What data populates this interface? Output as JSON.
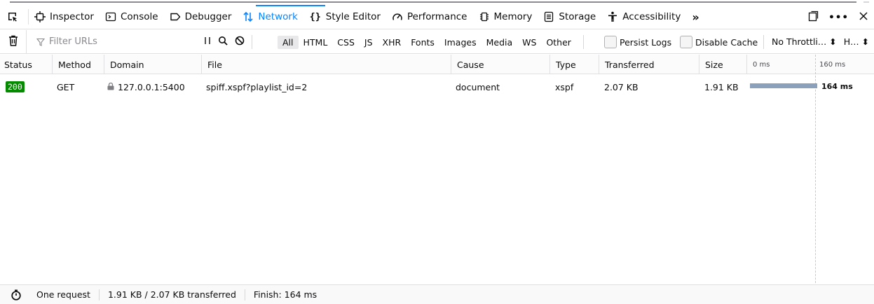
{
  "toolbox": {
    "tabs": [
      {
        "label": "Inspector",
        "icon": "inspector-icon"
      },
      {
        "label": "Console",
        "icon": "console-icon"
      },
      {
        "label": "Debugger",
        "icon": "debugger-icon"
      },
      {
        "label": "Network",
        "icon": "network-icon",
        "selected": true
      },
      {
        "label": "Style Editor",
        "icon": "style-editor-icon"
      },
      {
        "label": "Performance",
        "icon": "performance-icon"
      },
      {
        "label": "Memory",
        "icon": "memory-icon"
      },
      {
        "label": "Storage",
        "icon": "storage-icon"
      },
      {
        "label": "Accessibility",
        "icon": "accessibility-icon"
      }
    ],
    "overflow": "»",
    "accent": "#0a84ff"
  },
  "toolbar": {
    "filter_placeholder": "Filter URLs",
    "type_filters": [
      "All",
      "HTML",
      "CSS",
      "JS",
      "XHR",
      "Fonts",
      "Images",
      "Media",
      "WS",
      "Other"
    ],
    "persist_logs": "Persist Logs",
    "disable_cache": "Disable Cache",
    "throttling": "No Throttli… ⬍",
    "har": "H… ⬍"
  },
  "columns": {
    "status": "Status",
    "method": "Method",
    "domain": "Domain",
    "file": "File",
    "cause": "Cause",
    "type": "Type",
    "transferred": "Transferred",
    "size": "Size",
    "tick0": "0 ms",
    "tick1": "160 ms"
  },
  "row": {
    "status": "200",
    "method": "GET",
    "domain": "127.0.0.1:5400",
    "file": "spiff.xspf?playlist_id=2",
    "cause": "document",
    "type": "xspf",
    "transferred": "2.07 KB",
    "size": "1.91 KB",
    "timing": "164 ms",
    "status_color": "#058b00"
  },
  "statusbar": {
    "requests": "One request",
    "size": "1.91 KB / 2.07 KB transferred",
    "finish": "Finish: 164 ms"
  }
}
